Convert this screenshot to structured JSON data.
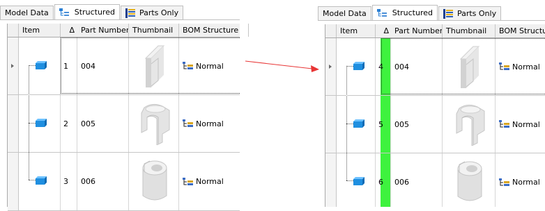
{
  "tabs": [
    "Model Data",
    "Structured",
    "Parts Only"
  ],
  "columns": {
    "item": "Item",
    "sort": "Δ",
    "part_number": "Part Number",
    "thumbnail": "Thumbnail",
    "bom": "BOM Structure"
  },
  "before": {
    "rows": [
      {
        "item": "1",
        "part_number": "004",
        "bom": "Normal"
      },
      {
        "item": "2",
        "part_number": "005",
        "bom": "Normal"
      },
      {
        "item": "3",
        "part_number": "006",
        "bom": "Normal"
      }
    ]
  },
  "after": {
    "rows": [
      {
        "item": "4",
        "part_number": "004",
        "bom": "Normal"
      },
      {
        "item": "5",
        "part_number": "005",
        "bom": "Normal"
      },
      {
        "item": "6",
        "part_number": "006",
        "bom": "Normal"
      }
    ]
  },
  "colors": {
    "highlight": "#3ef23e",
    "arrow": "#e83535",
    "part_icon": "#1f8fe0"
  }
}
